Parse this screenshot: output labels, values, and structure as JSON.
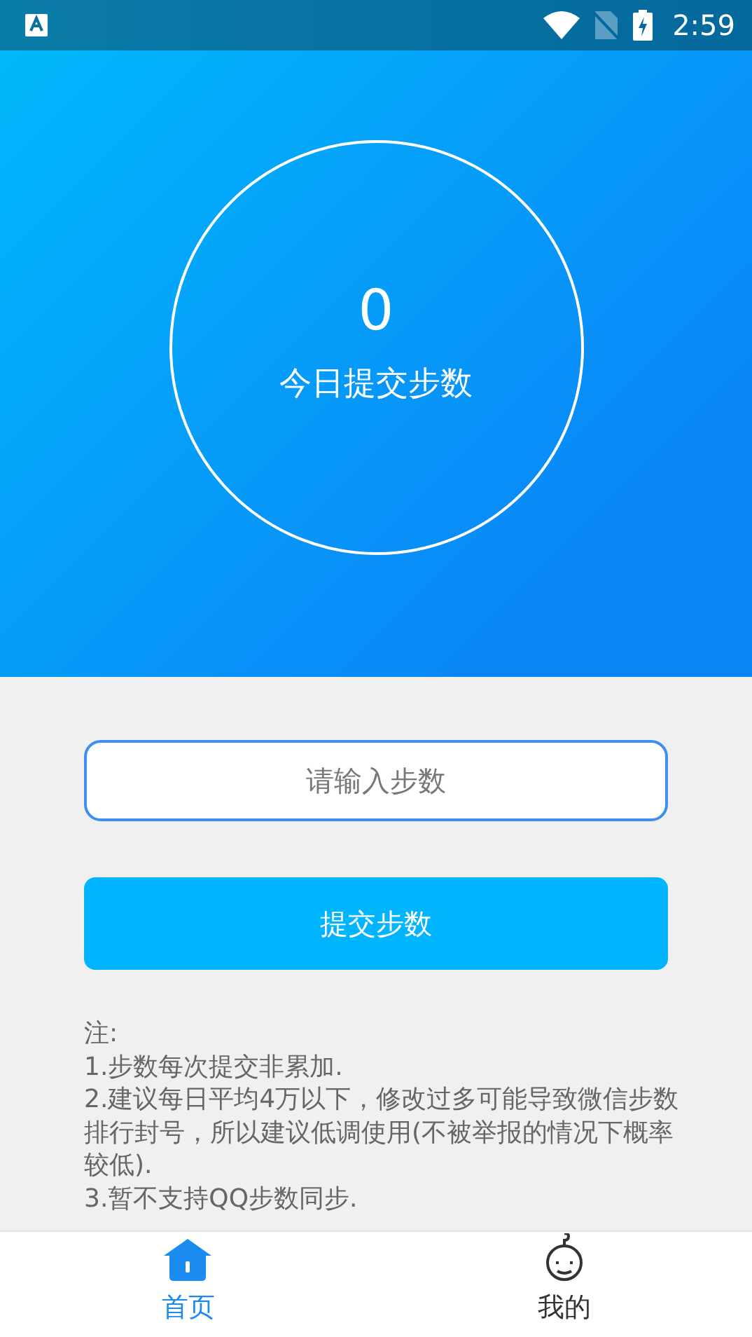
{
  "status_bar": {
    "time": "2:59"
  },
  "header": {
    "count": "0",
    "label": "今日提交步数"
  },
  "step_input": {
    "placeholder": "请输入步数"
  },
  "submit_button": {
    "label": "提交步数"
  },
  "notes": {
    "title": "注:",
    "lines": [
      "1.步数每次提交非累加.",
      "2.建议每日平均4万以下，修改过多可能导致微信步数排行封号，所以建议低调使用(不被举报的情况下概率较低).",
      "3.暂不支持QQ步数同步."
    ]
  },
  "tabs": [
    {
      "label": "首页",
      "selected": true,
      "kind": "home"
    },
    {
      "label": "我的",
      "selected": false,
      "kind": "profile"
    }
  ]
}
